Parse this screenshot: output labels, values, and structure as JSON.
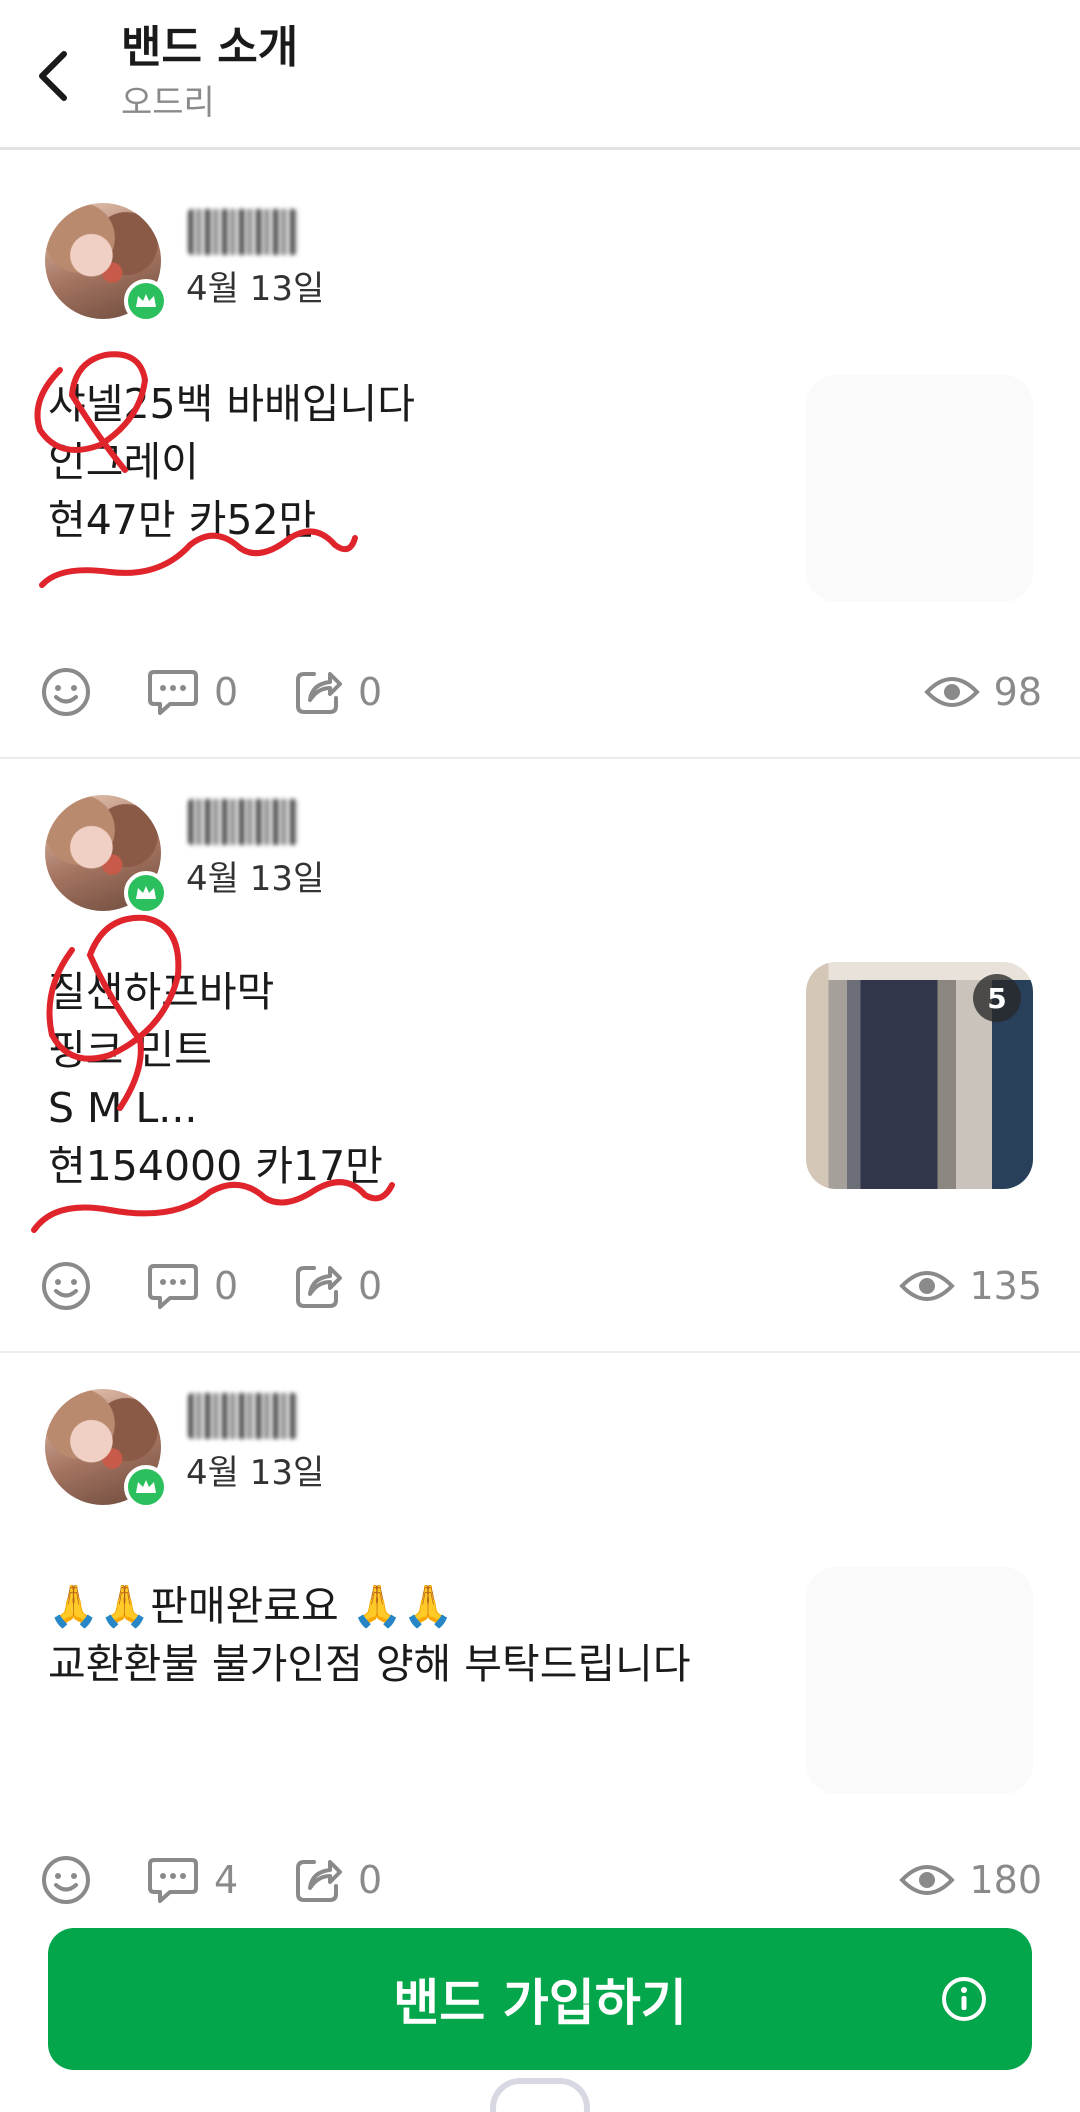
{
  "header": {
    "title": "밴드 소개",
    "subtitle": "오드리"
  },
  "posts": [
    {
      "date": "4월 13일",
      "lines": [
        "샤넬25백 바배입니다",
        "인그레이",
        "현47만 카52만"
      ],
      "likes_icon": "smile-icon",
      "comments": "0",
      "shares": "0",
      "views": "98",
      "has_thumbnail": false
    },
    {
      "date": "4월 13일",
      "lines": [
        "질샌하프바막",
        "핑크 민트",
        "S M L...",
        "현154000 카17만"
      ],
      "comments": "0",
      "shares": "0",
      "views": "135",
      "has_thumbnail": true,
      "thumbnail_count": "5"
    },
    {
      "date": "4월 13일",
      "lines": [
        "🙏🙏판매완료요 🙏🙏",
        "교환환불 불가인점 양해 부탁드립니다"
      ],
      "comments": "4",
      "shares": "0",
      "views": "180",
      "has_thumbnail": false
    }
  ],
  "join": {
    "label": "밴드 가입하기"
  },
  "colors": {
    "brand_green": "#03a64a",
    "badge_green": "#2cbf5d",
    "annotation_red": "#e0242b",
    "muted_text": "#8a8a8a"
  },
  "icons": {
    "back": "chevron-left-icon",
    "reaction": "smile-icon",
    "comment": "comment-bubble-icon",
    "share": "share-icon",
    "views": "eye-icon",
    "info": "info-icon",
    "badge": "crown-icon"
  }
}
